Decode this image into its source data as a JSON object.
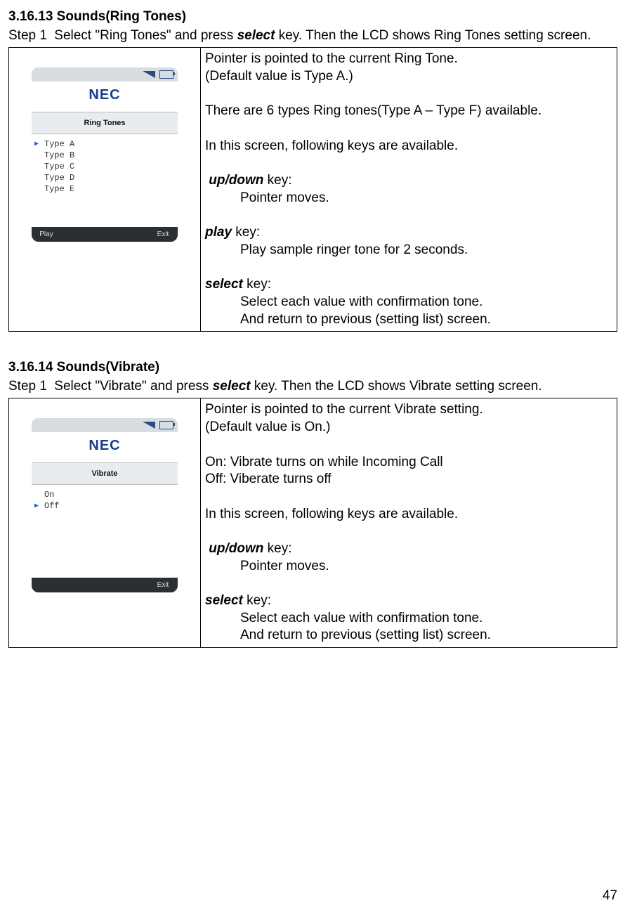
{
  "section1": {
    "heading": "3.16.13  Sounds(Ring Tones)",
    "step_label": "Step 1",
    "step_text_a": "Select \"Ring Tones\" and press ",
    "step_text_key": "select",
    "step_text_b": " key. Then the LCD shows Ring Tones setting screen.",
    "desc": {
      "p1": "Pointer is pointed to the current Ring Tone.",
      "p2": "(Default value is Type A.)",
      "p3": "There are 6 types Ring tones(Type A – Type F) available.",
      "p4": "In this screen, following keys are available.",
      "k1_name": "up/down",
      "k1_suffix": " key:",
      "k1_desc": "Pointer moves.",
      "k2_name": "play",
      "k2_suffix": " key:",
      "k2_desc": "Play sample ringer tone for 2 seconds.",
      "k3_name": "select",
      "k3_suffix": " key:",
      "k3_desc1": "Select each value with confirmation tone.",
      "k3_desc2": "And return to previous (setting list) screen."
    },
    "phone": {
      "brand": "NEC",
      "title": "Ring Tones",
      "items": [
        "Type A",
        "Type B",
        "Type C",
        "Type D",
        "Type E"
      ],
      "pointer_index": 0,
      "soft_left": "Play",
      "soft_right": "Exit"
    }
  },
  "section2": {
    "heading": "3.16.14  Sounds(Vibrate)",
    "step_label": "Step 1",
    "step_text_a": "Select \"Vibrate\" and press ",
    "step_text_key": "select",
    "step_text_b": " key. Then the LCD shows Vibrate setting screen.",
    "desc": {
      "p1": "Pointer is pointed to the current Vibrate setting.",
      "p2": "(Default value is On.)",
      "p3": "On: Vibrate turns on while Incoming Call",
      "p4": "Off: Viberate turns off",
      "p5": "In this screen, following keys are available.",
      "k1_name": "up/down",
      "k1_suffix": " key:",
      "k1_desc": "Pointer moves.",
      "k2_name": "select",
      "k2_suffix": " key:",
      "k2_desc1": "Select each value with confirmation tone.",
      "k2_desc2": "And return to previous (setting list) screen."
    },
    "phone": {
      "brand": "NEC",
      "title": "Vibrate",
      "items": [
        "On",
        "Off"
      ],
      "pointer_index": 1,
      "soft_left": "",
      "soft_right": "Exit"
    }
  },
  "page_number": "47"
}
